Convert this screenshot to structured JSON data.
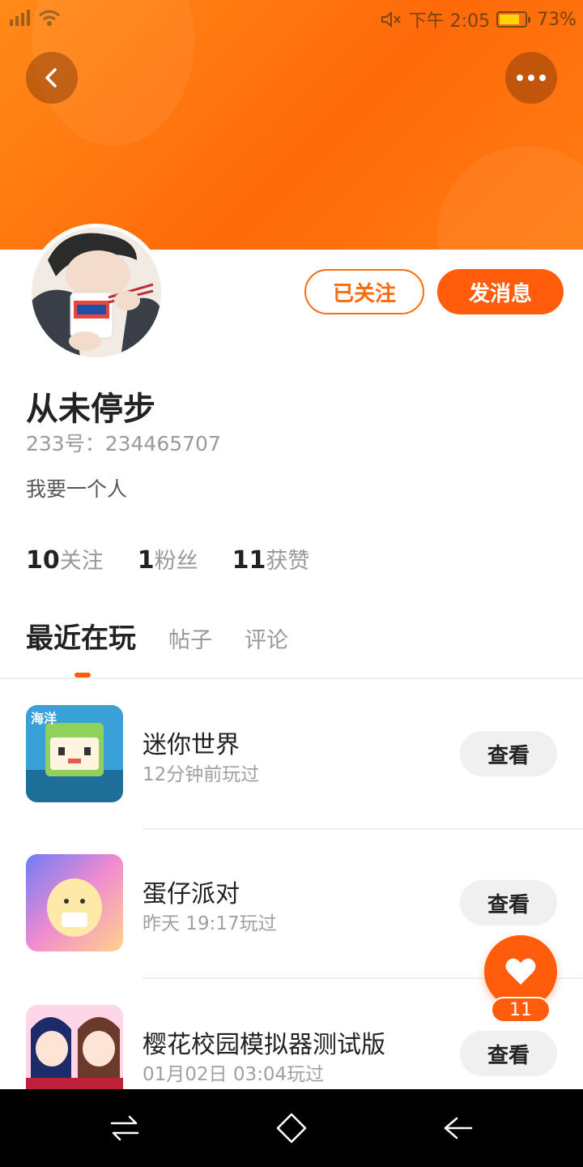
{
  "status_bar": {
    "time": "下午 2:05",
    "battery": "73%"
  },
  "header": {
    "back_icon": "chevron-left-icon",
    "more_icon": "more-horizontal-icon"
  },
  "profile": {
    "follow_state_label": "已关注",
    "message_label": "发消息",
    "name": "从未停步",
    "id_text": "233号：234465707",
    "bio": "我要一个人",
    "stats": [
      {
        "value": "10",
        "label": "关注"
      },
      {
        "value": "1",
        "label": "粉丝"
      },
      {
        "value": "11",
        "label": "获赞"
      }
    ]
  },
  "tabs": [
    {
      "label": "最近在玩",
      "active": true
    },
    {
      "label": "帖子",
      "active": false
    },
    {
      "label": "评论",
      "active": false
    }
  ],
  "games": [
    {
      "name": "迷你世界",
      "played": "12分钟前玩过",
      "button": "查看"
    },
    {
      "name": "蛋仔派对",
      "played": "昨天 19:17玩过",
      "button": "查看"
    },
    {
      "name": "樱花校园模拟器测试版",
      "played": "01月02日 03:04玩过",
      "button": "查看"
    }
  ],
  "like": {
    "count": "11",
    "icon": "heart-icon"
  },
  "colors": {
    "accent": "#ff5c0b",
    "banner": "#ff7a12"
  }
}
